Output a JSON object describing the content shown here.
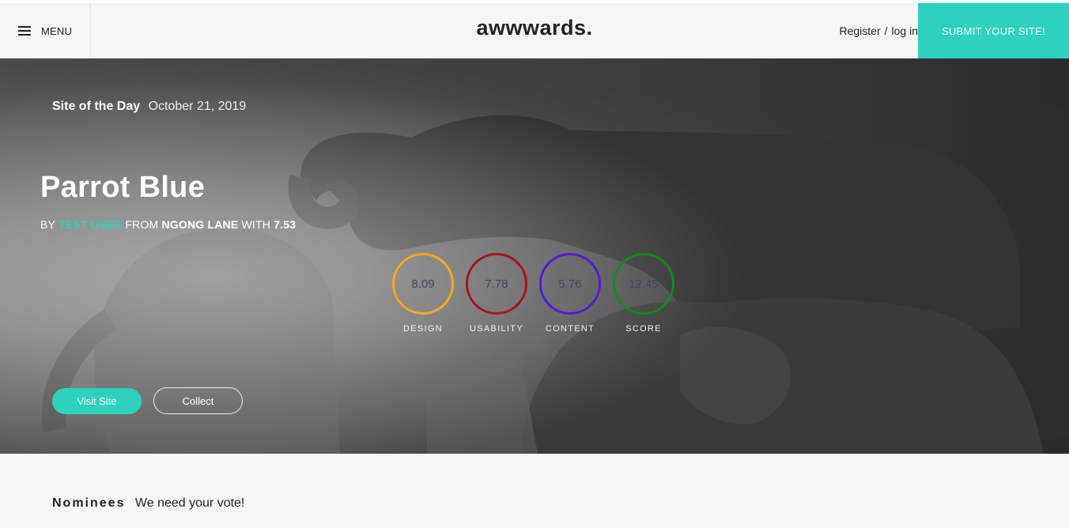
{
  "header": {
    "menu_label": "MENU",
    "menu_icon": "hamburger-icon",
    "logo": "awwwards.",
    "register_label": "Register",
    "separator": "/",
    "login_label": "log in",
    "submit_label": "SUBMIT YOUR SITE!"
  },
  "hero": {
    "sotd_label": "Site of the Day",
    "date": "October 21, 2019",
    "title": "Parrot Blue",
    "by_prefix": "BY",
    "user": "TEST USER",
    "from_text": "FROM",
    "location": "NGONG LANE",
    "with_text": "WITH",
    "rating": "7.53",
    "scores": [
      {
        "label": "DESIGN",
        "value": "8.09",
        "color": "#f4a81c"
      },
      {
        "label": "USABILITY",
        "value": "7.78",
        "color": "#a8141c"
      },
      {
        "label": "CONTENT",
        "value": "5.76",
        "color": "#5a17d6"
      },
      {
        "label": "SCORE",
        "value": "12.45",
        "color": "#128c16"
      }
    ],
    "visit_label": "Visit Site",
    "collect_label": "Collect"
  },
  "nominees": {
    "heading": "Nominees",
    "subtitle": "We need your vote!"
  },
  "colors": {
    "accent": "#2dd1be",
    "background": "#f5f6f5"
  }
}
